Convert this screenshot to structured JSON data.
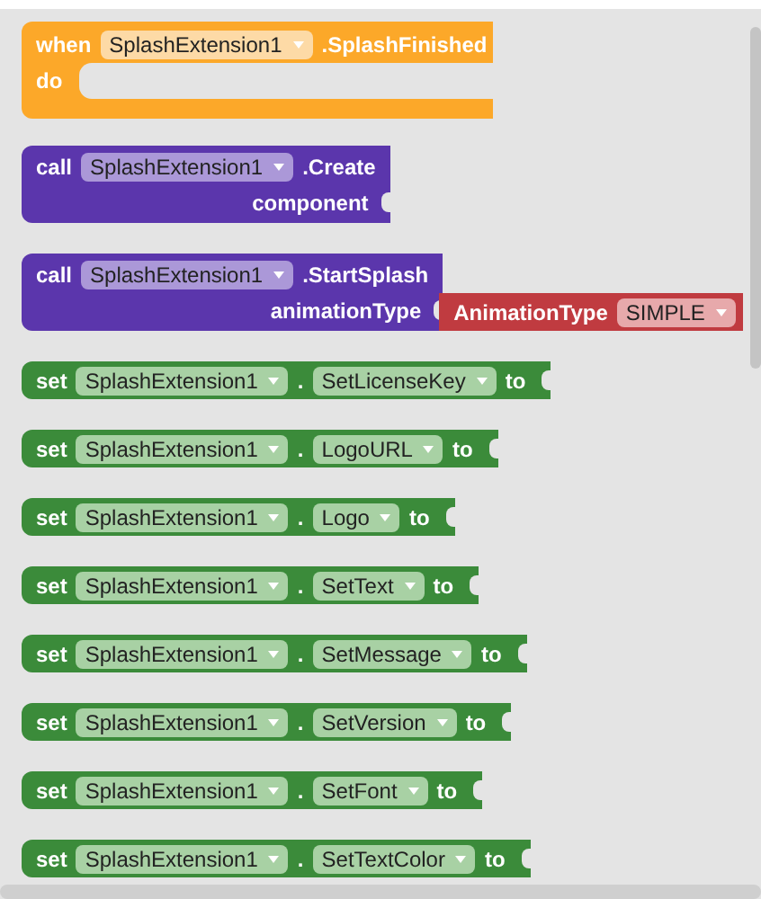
{
  "blocks": [
    {
      "kind": "event",
      "keyword": "when",
      "component": "SplashExtension1",
      "event": ".SplashFinished",
      "do_label": "do"
    },
    {
      "kind": "method",
      "keyword": "call",
      "component": "SplashExtension1",
      "method": ".Create",
      "argument": "component"
    },
    {
      "kind": "method",
      "keyword": "call",
      "component": "SplashExtension1",
      "method": ".StartSplash",
      "argument": "animationType",
      "attached": {
        "kind": "helper",
        "label": "AnimationType",
        "option": "SIMPLE"
      }
    },
    {
      "kind": "setter",
      "keyword": "set",
      "component": "SplashExtension1",
      "dot": ".",
      "property": "SetLicenseKey",
      "to": "to"
    },
    {
      "kind": "setter",
      "keyword": "set",
      "component": "SplashExtension1",
      "dot": ".",
      "property": "LogoURL",
      "to": "to"
    },
    {
      "kind": "setter",
      "keyword": "set",
      "component": "SplashExtension1",
      "dot": ".",
      "property": "Logo",
      "to": "to"
    },
    {
      "kind": "setter",
      "keyword": "set",
      "component": "SplashExtension1",
      "dot": ".",
      "property": "SetText",
      "to": "to"
    },
    {
      "kind": "setter",
      "keyword": "set",
      "component": "SplashExtension1",
      "dot": ".",
      "property": "SetMessage",
      "to": "to"
    },
    {
      "kind": "setter",
      "keyword": "set",
      "component": "SplashExtension1",
      "dot": ".",
      "property": "SetVersion",
      "to": "to"
    },
    {
      "kind": "setter",
      "keyword": "set",
      "component": "SplashExtension1",
      "dot": ".",
      "property": "SetFont",
      "to": "to"
    },
    {
      "kind": "setter",
      "keyword": "set",
      "component": "SplashExtension1",
      "dot": ".",
      "property": "SetTextColor",
      "to": "to"
    }
  ]
}
